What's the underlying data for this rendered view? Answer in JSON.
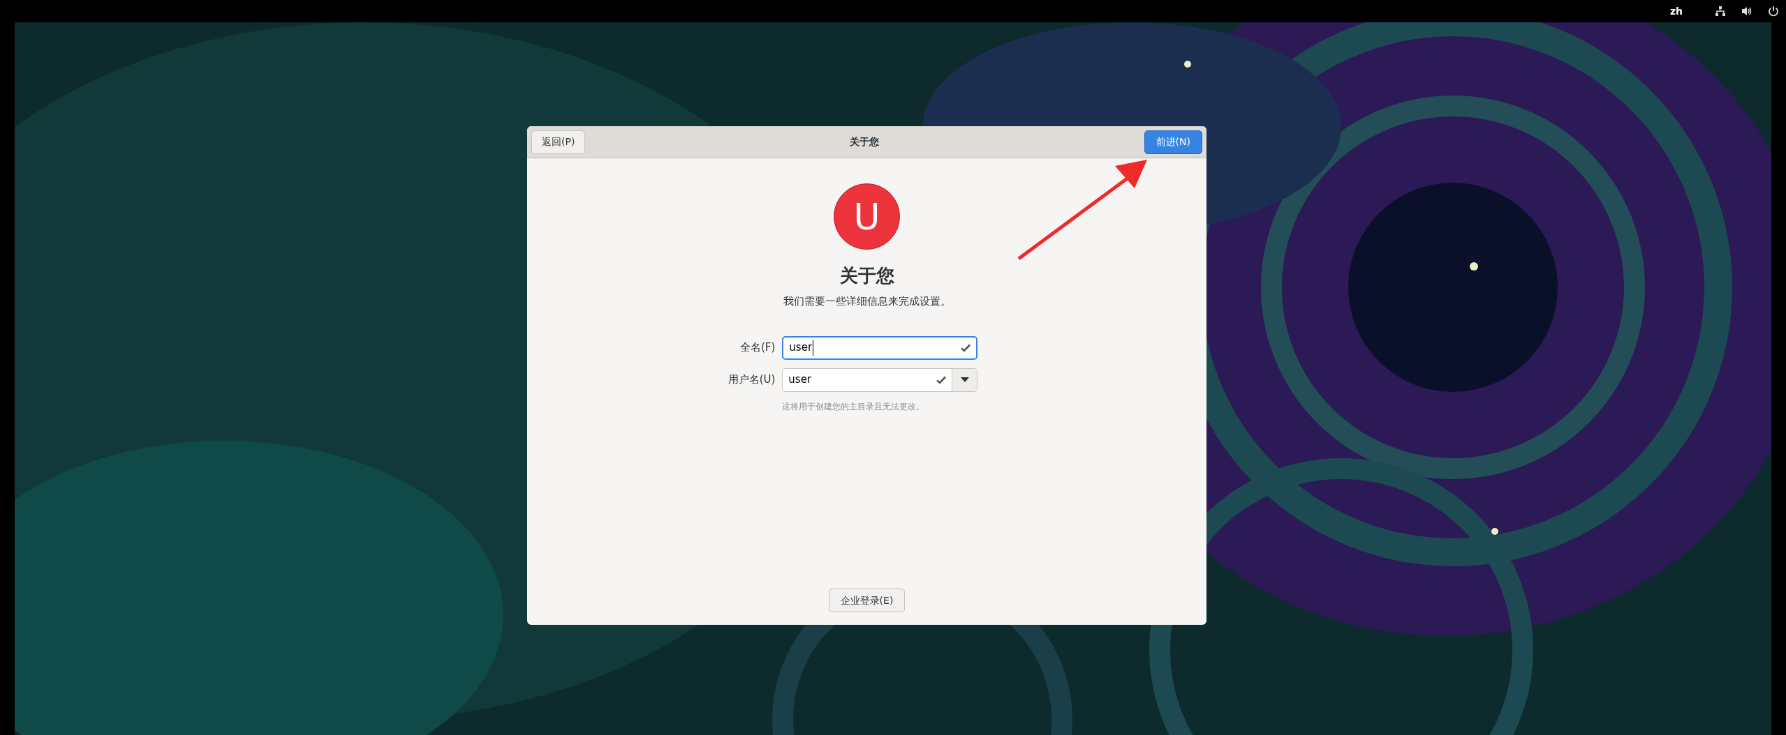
{
  "top_bar": {
    "language": "zh"
  },
  "dialog": {
    "back_button": "返回(P)",
    "title": "关于您",
    "next_button": "前进(N)",
    "avatar_letter": "U",
    "heading": "关于您",
    "subtitle": "我们需要一些详细信息来完成设置。",
    "fields": [
      {
        "label": "全名(F)",
        "value": "user",
        "focused": true,
        "valid": true,
        "kind": "text"
      },
      {
        "label": "用户名(U)",
        "value": "user",
        "focused": false,
        "valid": true,
        "kind": "combo"
      }
    ],
    "hint": "这将用于创建您的主目录且无法更改。",
    "enterprise_button": "企业登录(E)"
  }
}
